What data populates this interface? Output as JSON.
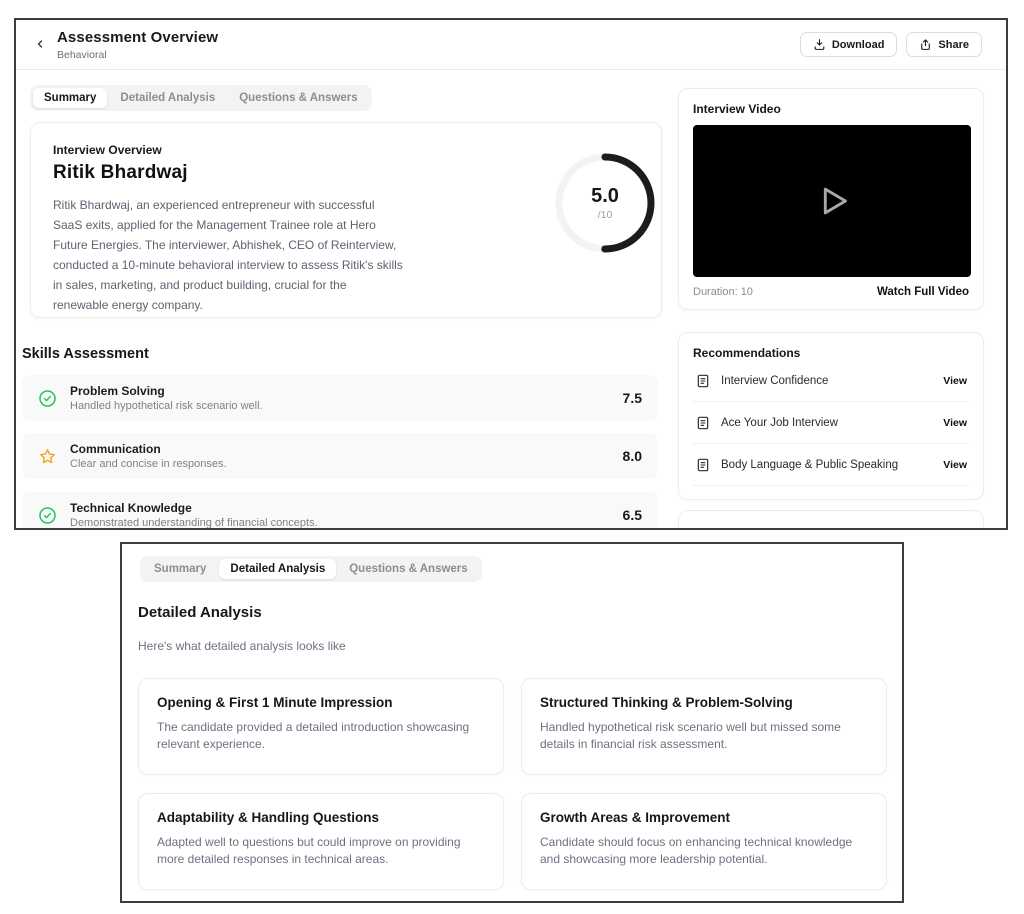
{
  "header": {
    "title": "Assessment Overview",
    "subtitle": "Behavioral",
    "download_label": "Download",
    "share_label": "Share"
  },
  "tabs_top": {
    "items": [
      {
        "label": "Summary",
        "active": true
      },
      {
        "label": "Detailed Analysis",
        "active": false
      },
      {
        "label": "Questions & Answers",
        "active": false
      }
    ]
  },
  "overview": {
    "section_label": "Interview Overview",
    "candidate_name": "Ritik Bhardwaj",
    "description": "Ritik Bhardwaj, an experienced entrepreneur with successful SaaS exits, applied for the Management Trainee role at Hero Future Energies. The interviewer, Abhishek, CEO of Reinterview, conducted a 10-minute behavioral interview to assess Ritik's skills in sales, marketing, and product building, crucial for the renewable energy company.",
    "score": "5.0",
    "score_max": "/10",
    "score_fraction": 0.5
  },
  "video": {
    "title": "Interview Video",
    "duration": "Duration: 10",
    "watch_label": "Watch Full Video"
  },
  "skills": {
    "title": "Skills Assessment",
    "items": [
      {
        "icon": "check-circle",
        "name": "Problem Solving",
        "desc": "Handled hypothetical risk scenario well.",
        "score": "7.5"
      },
      {
        "icon": "star",
        "name": "Communication",
        "desc": "Clear and concise in responses.",
        "score": "8.0"
      },
      {
        "icon": "check-circle",
        "name": "Technical Knowledge",
        "desc": "Demonstrated understanding of financial concepts.",
        "score": "6.5"
      }
    ]
  },
  "recommendations": {
    "title": "Recommendations",
    "view_label": "View",
    "items": [
      {
        "label": "Interview Confidence"
      },
      {
        "label": "Ace Your Job Interview"
      },
      {
        "label": "Body Language & Public Speaking"
      }
    ]
  },
  "detail_panel": {
    "tabs": [
      {
        "label": "Summary",
        "active": false
      },
      {
        "label": "Detailed Analysis",
        "active": true
      },
      {
        "label": "Questions & Answers",
        "active": false
      }
    ],
    "title": "Detailed Analysis",
    "subtitle": "Here's what detailed analysis looks like",
    "cards": [
      {
        "title": "Opening & First 1 Minute Impression",
        "desc": "The candidate provided a detailed introduction showcasing relevant experience."
      },
      {
        "title": "Structured Thinking & Problem-Solving",
        "desc": "Handled hypothetical risk scenario well but missed some details in financial risk assessment."
      },
      {
        "title": "Adaptability & Handling Questions",
        "desc": "Adapted well to questions but could improve on providing more detailed responses in technical areas."
      },
      {
        "title": "Growth Areas & Improvement",
        "desc": "Candidate should focus on enhancing technical knowledge and showcasing more leadership potential."
      }
    ]
  },
  "colors": {
    "success_green": "#22c55e",
    "star_amber": "#f2a41f",
    "video_bg": "#000000",
    "panel_border": "#3d3d3d"
  }
}
